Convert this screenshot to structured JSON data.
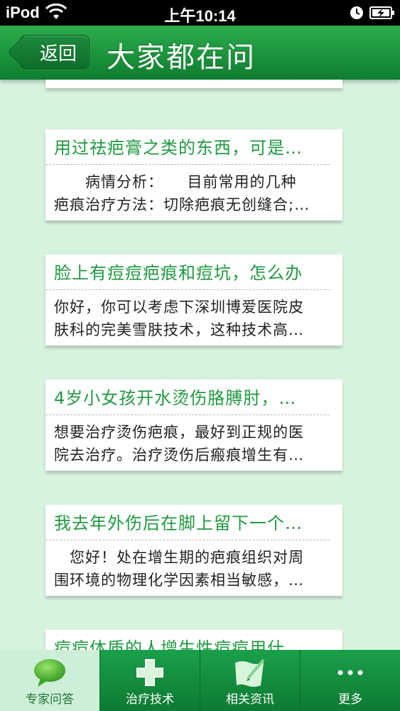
{
  "status_bar": {
    "carrier": "iPod",
    "time": "上午10:14"
  },
  "nav": {
    "back_label": "返回",
    "title": "大家都在问"
  },
  "questions": [
    {
      "title": "用过祛疤膏之类的东西，可是…",
      "lines": [
        "　　病情分析：　　目前常用的几种",
        "疤痕治疗方法：切除疤痕无创缝合;…"
      ]
    },
    {
      "title": "脸上有痘痘疤痕和痘坑，怎么办",
      "lines": [
        "你好，你可以考虑下深圳博爱医院皮",
        "肤科的完美雪肤技术，这种技术高…"
      ]
    },
    {
      "title": "4岁小女孩开水烫伤胳膊肘，…",
      "lines": [
        "想要治疗烫伤疤痕，最好到正规的医",
        "院去治疗。治疗烫伤后瘢痕增生有…"
      ]
    },
    {
      "title": "我去年外伤后在脚上留下一个…",
      "lines": [
        "　您好！处在增生期的疤痕组织对周",
        "围环境的物理化学因素相当敏感，…"
      ]
    },
    {
      "title": "痘痘体质的人增生性痘痘用什…",
      "lines": [
        "",
        ""
      ]
    }
  ],
  "tabs": [
    {
      "label": "专家问答",
      "icon": "speech-bubble-icon"
    },
    {
      "label": "治疗技术",
      "icon": "medical-cross-icon"
    },
    {
      "label": "相关资讯",
      "icon": "news-pen-icon"
    },
    {
      "label": "更多",
      "icon": "more-dots-icon"
    }
  ]
}
